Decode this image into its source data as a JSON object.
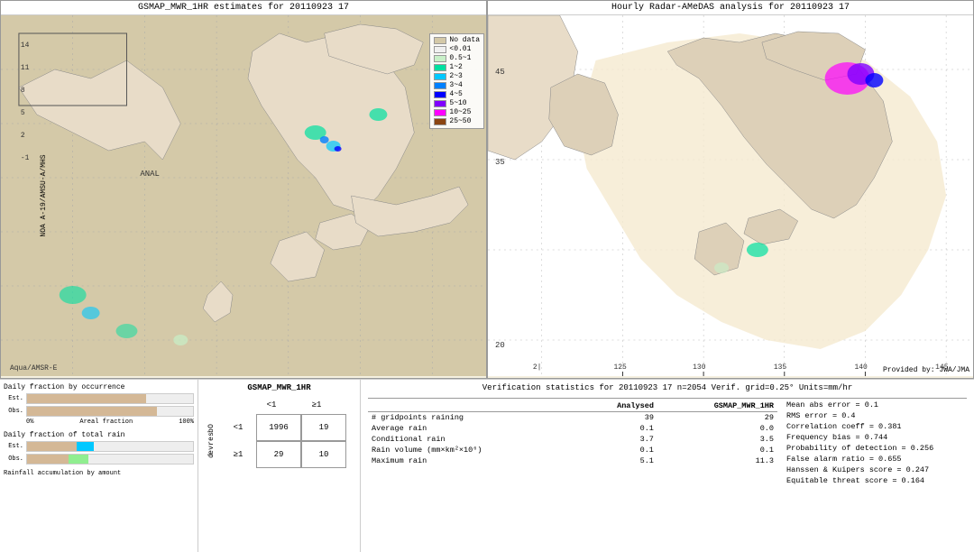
{
  "left_map": {
    "title": "GSMAP_MWR_1HR estimates for 20110923 17",
    "y_axis_label": "NOA A-19/AMSU-A/MHS",
    "x_label_bottom": "Aqua/AMSR-E",
    "anal_label": "ANAL",
    "legend": {
      "title": "No data",
      "items": [
        {
          "label": "No data",
          "color": "#d4c9a8"
        },
        {
          "label": "<0.01",
          "color": "#f5f5f5"
        },
        {
          "label": "0.5~1",
          "color": "#c8f0c8"
        },
        {
          "label": "1~2",
          "color": "#00e0a0"
        },
        {
          "label": "2~3",
          "color": "#00c8ff"
        },
        {
          "label": "3~4",
          "color": "#0080ff"
        },
        {
          "label": "4~5",
          "color": "#0000ff"
        },
        {
          "label": "5~10",
          "color": "#8000ff"
        },
        {
          "label": "10~25",
          "color": "#ff00ff"
        },
        {
          "label": "25~50",
          "color": "#8b4513"
        }
      ]
    }
  },
  "right_map": {
    "title": "Hourly Radar-AMeDAS analysis for 20110923 17",
    "provided_by": "Provided by: JWA/JMA",
    "lat_labels": [
      "45",
      "35",
      "20"
    ],
    "lon_labels": [
      "125",
      "130",
      "135",
      "140",
      "145"
    ]
  },
  "bar_charts": {
    "occurrence_title": "Daily fraction by occurrence",
    "total_rain_title": "Daily fraction of total rain",
    "rainfall_note": "Rainfall accumulation by amount",
    "est_label": "Est.",
    "obs_label": "Obs.",
    "axis_labels": [
      "0%",
      "Areal fraction",
      "100%"
    ]
  },
  "contingency": {
    "title": "GSMAP_MWR_1HR",
    "col_headers": [
      "<1",
      "≥1"
    ],
    "row_headers": [
      "<1",
      "≥1"
    ],
    "observed_label": "O b s e r v e d",
    "cells": [
      [
        1996,
        19
      ],
      [
        29,
        10
      ]
    ]
  },
  "verification": {
    "title": "Verification statistics for 20110923 17  n=2054  Verif. grid=0.25°  Units=mm/hr",
    "table": {
      "headers": [
        "",
        "Analysed",
        "GSMAP_MWR_1HR"
      ],
      "rows": [
        {
          "label": "# gridpoints raining",
          "analysed": "39",
          "gsmap": "29"
        },
        {
          "label": "Average rain",
          "analysed": "0.1",
          "gsmap": "0.0"
        },
        {
          "label": "Conditional rain",
          "analysed": "3.7",
          "gsmap": "3.5"
        },
        {
          "label": "Rain volume (mm×km²×10⁶)",
          "analysed": "0.1",
          "gsmap": "0.1"
        },
        {
          "label": "Maximum rain",
          "analysed": "5.1",
          "gsmap": "11.3"
        }
      ]
    },
    "scores": [
      {
        "label": "Mean abs error = 0.1"
      },
      {
        "label": "RMS error = 0.4"
      },
      {
        "label": "Correlation coeff = 0.381"
      },
      {
        "label": "Frequency bias = 0.744"
      },
      {
        "label": "Probability of detection = 0.256"
      },
      {
        "label": "False alarm ratio = 0.655"
      },
      {
        "label": "Hanssen & Kuipers score = 0.247"
      },
      {
        "label": "Equitable threat score = 0.164"
      }
    ]
  }
}
